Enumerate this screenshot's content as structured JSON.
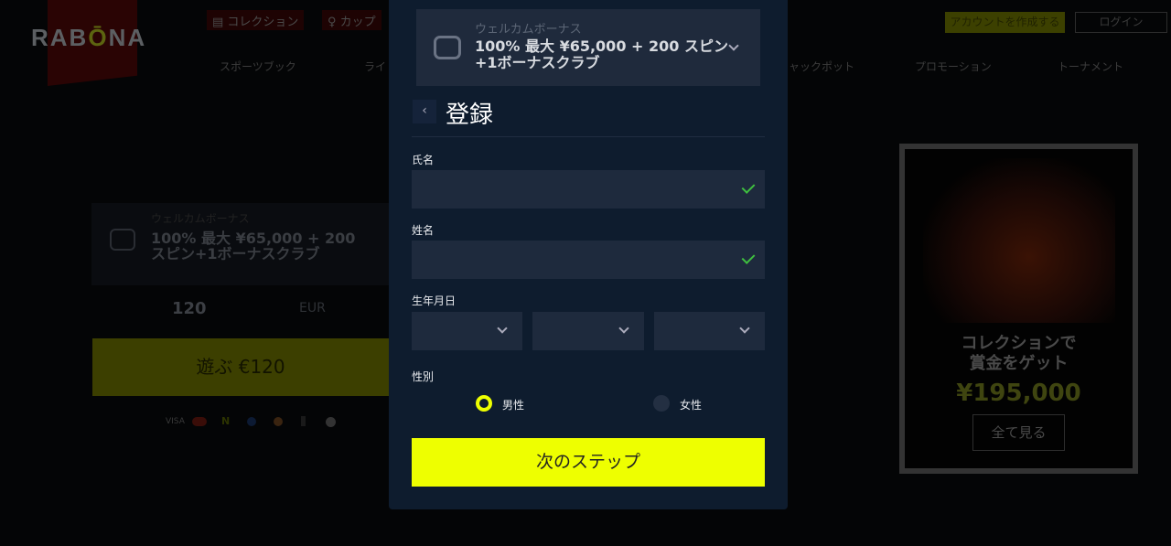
{
  "header": {
    "logo": "RABŌNA",
    "tabs": [
      "コレクション",
      "カップ"
    ],
    "nav": [
      "スポーツブック",
      "ライ",
      "ャックポット",
      "プロモーション",
      "トーナメント"
    ],
    "create_account": "アカウントを作成する",
    "login": "ログイン"
  },
  "background_bonus": {
    "subtitle": "ウェルカムボーナス",
    "title": "100% 最大 ¥65,000 + 200 スピン+1ボーナスクラブ",
    "amount": "120",
    "currency": "EUR",
    "play": "遊ぶ €120",
    "payments": [
      "VISA",
      "mastercard",
      "N",
      "ripple",
      "circle",
      "eth",
      "litecoin"
    ]
  },
  "promo_card": {
    "title_line1": "コレクションで",
    "title_line2": "賞金をゲット",
    "amount": "¥195,000",
    "view_all": "全て見る"
  },
  "modal": {
    "bonus": {
      "subtitle": "ウェルカムボーナス",
      "title_line1": "100% 最大 ¥65,000 + 200 スピン",
      "title_line2": "+1ボーナスクラブ",
      "icon": "slot-machine-icon"
    },
    "title": "登録",
    "first_name_label": "氏名",
    "first_name_value": "",
    "last_name_label": "姓名",
    "last_name_value": "",
    "dob_label": "生年月日",
    "dob": {
      "day": "",
      "month": "",
      "year": ""
    },
    "gender_label": "性別",
    "gender_options": [
      "男性",
      "女性"
    ],
    "gender_selected": "男性",
    "next": "次のステップ",
    "colors": {
      "accent": "#eeff00",
      "panel": "#0e1c2e",
      "input": "#1e2a3d",
      "valid": "#3fbf3f"
    }
  }
}
